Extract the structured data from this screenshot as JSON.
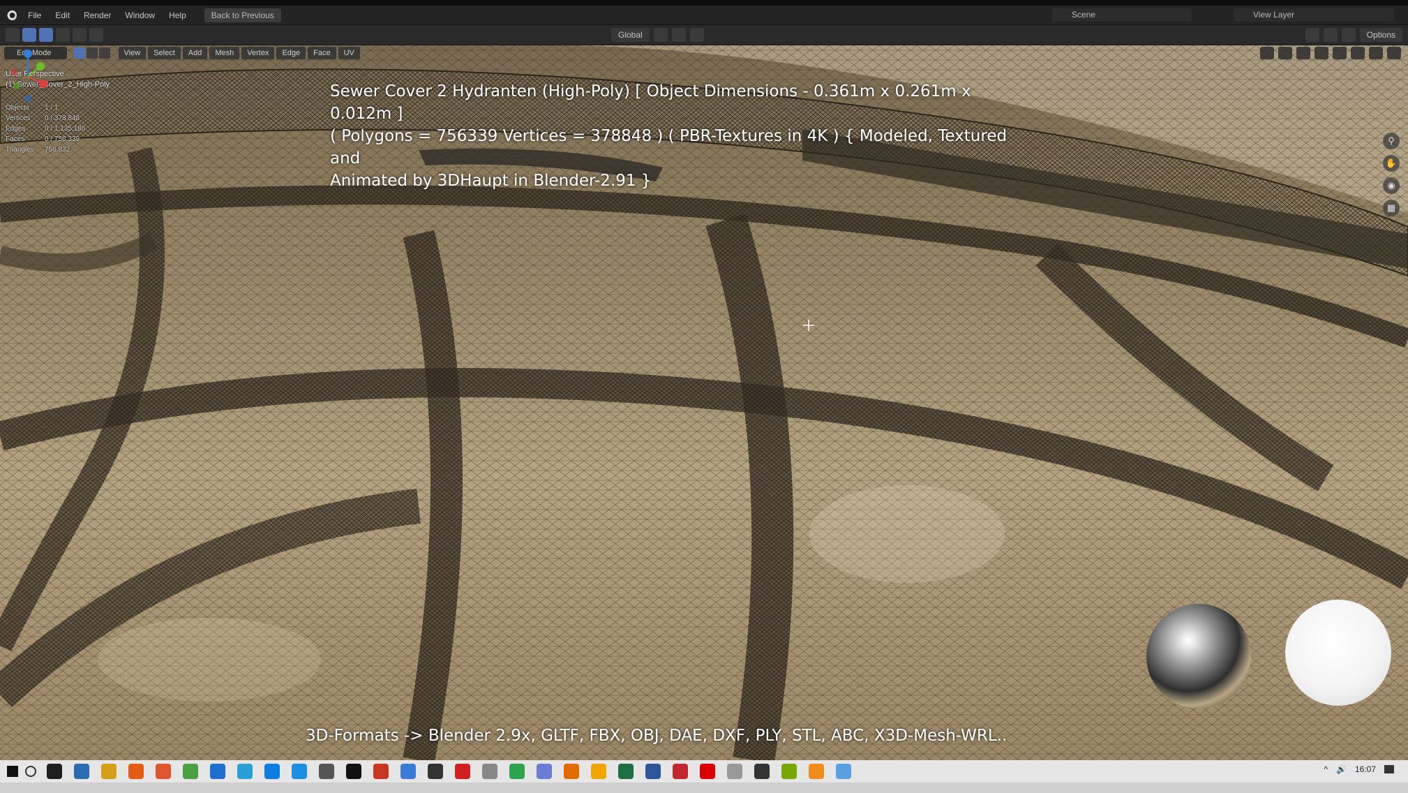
{
  "menubar": {
    "items": [
      "File",
      "Edit",
      "Render",
      "Window",
      "Help"
    ],
    "back_button": "Back to Previous",
    "scene": "Scene",
    "view_layer": "View Layer"
  },
  "toolbar": {
    "orientation": "Global",
    "options": "Options"
  },
  "viewport_header": {
    "mode": "Edit Mode",
    "menus": [
      "View",
      "Select",
      "Add",
      "Mesh",
      "Vertex",
      "Edge",
      "Face",
      "UV"
    ]
  },
  "overlay": {
    "view_name": "User Perspective",
    "object_name": "(1) Sewer_Cover_2_High-Poly",
    "stats": [
      {
        "label": "Objects",
        "value": "1 / 1"
      },
      {
        "label": "Vertices",
        "value": "0 / 378,848"
      },
      {
        "label": "Edges",
        "value": "0 / 1,135,186"
      },
      {
        "label": "Faces",
        "value": "0 / 756,339"
      },
      {
        "label": "Triangles",
        "value": "756,832"
      }
    ]
  },
  "caption": {
    "line1": "Sewer Cover 2 Hydranten (High-Poly) [ Object Dimensions -  0.361m x 0.261m x 0.012m ]",
    "line2": "( Polygons = 756339 Vertices = 378848 ) ( PBR-Textures in 4K ) { Modeled, Textured and",
    "line3": "Animated by 3DHaupt in Blender-2.91 }"
  },
  "formats": "3D-Formats -> Blender 2.9x, GLTF, FBX, OBJ, DAE, DXF, PLY, STL, ABC, X3D-Mesh-WRL..",
  "taskbar": {
    "clock": "16:07",
    "icon_colors": [
      "#1e1e1e",
      "#2b6cb0",
      "#d4a017",
      "#e55b13",
      "#e0542e",
      "#48a23f",
      "#1f6fd1",
      "#2a9fd6",
      "#0b7de3",
      "#1d8fe1",
      "#555",
      "#111",
      "#c8371e",
      "#3a7bd5",
      "#333",
      "#d11f1f",
      "#888",
      "#2ea44f",
      "#6b7bd6",
      "#e06c00",
      "#f0a500",
      "#1d6f42",
      "#2b579a",
      "#c2272d",
      "#d00",
      "#999",
      "#333",
      "#7aa600",
      "#f28b1c",
      "#5aa0e0"
    ]
  },
  "colors": {
    "blender_header": "#232323",
    "selected_blue": "#4f73b3",
    "taskbar_bg": "#e6e6e6"
  }
}
